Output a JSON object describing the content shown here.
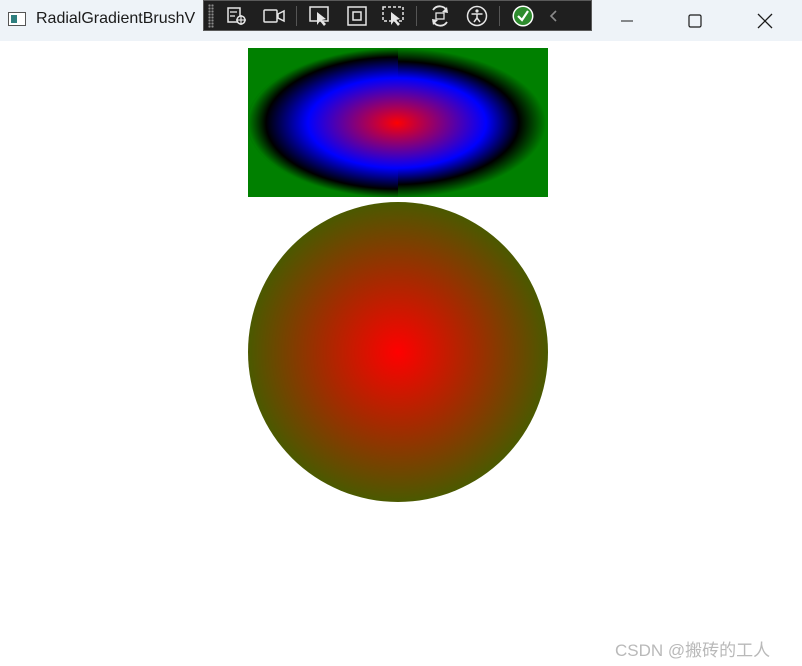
{
  "window": {
    "title": "RadialGradientBrushV",
    "controls": [
      "minimize",
      "maximize",
      "close"
    ]
  },
  "debug_toolbar": {
    "buttons": [
      "live-visual-tree-icon",
      "record-icon",
      "select-element-icon",
      "display-layout-adorners-icon",
      "track-focus-icon",
      "hot-reload-icon",
      "accessibility-icon",
      "binding-check-icon",
      "collapse-chevron-icon"
    ]
  },
  "canvas": {
    "rectangle": {
      "brush": "RadialGradientBrush",
      "colors": [
        "#ff0000",
        "#0000ff",
        "#000000"
      ],
      "background": "#008000"
    },
    "circle": {
      "brush": "RadialGradientBrush",
      "colors": [
        "#ff0000",
        "#008000"
      ]
    }
  },
  "watermark": "CSDN @搬砖的工人"
}
